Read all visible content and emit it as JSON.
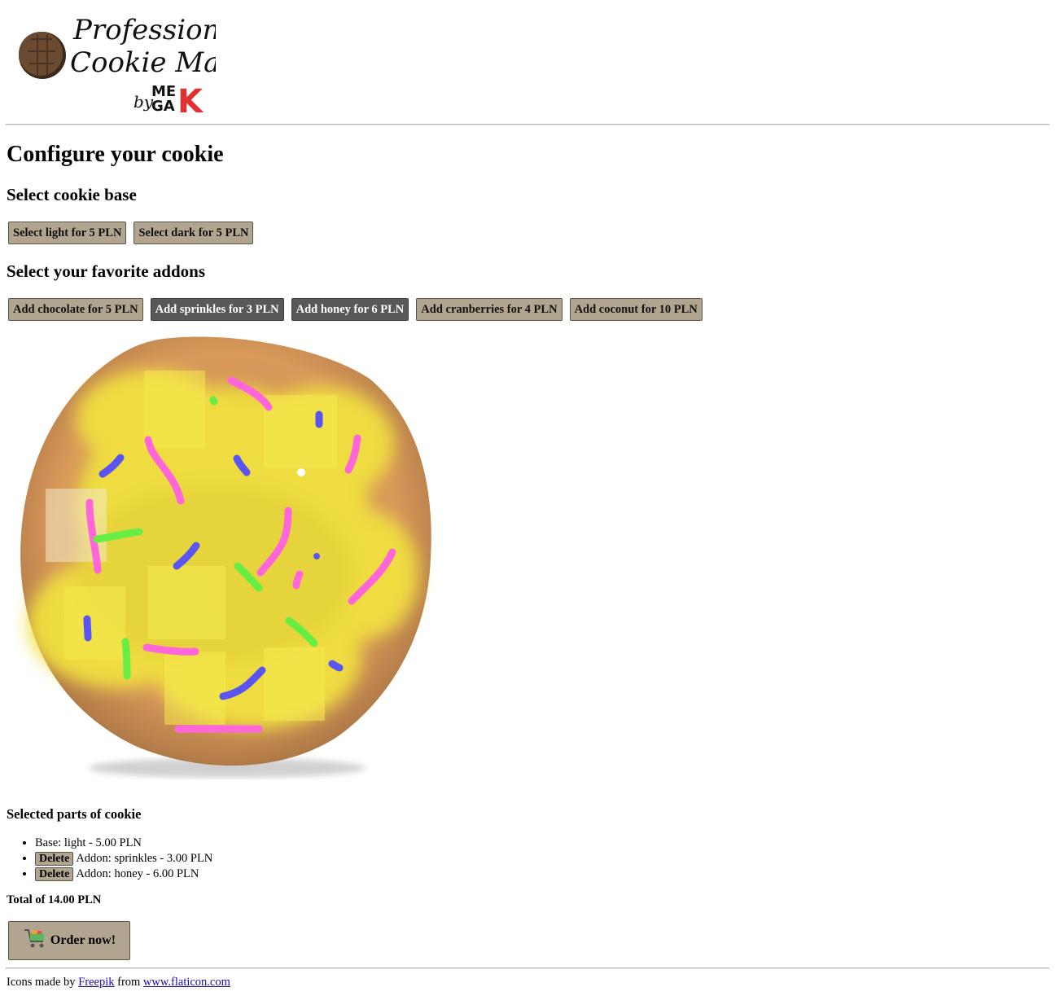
{
  "logo": {
    "line1": "Professional",
    "line2": "Cookie Maker",
    "by": "by",
    "brand_top": "ME",
    "brand_bottom": "GA",
    "brand_x": "K"
  },
  "page_title": "Configure your cookie",
  "base_section": {
    "heading": "Select cookie base",
    "buttons": [
      {
        "label": "Select light for 5 PLN",
        "active": false
      },
      {
        "label": "Select dark for 5 PLN",
        "active": false
      }
    ]
  },
  "addons_section": {
    "heading": "Select your favorite addons",
    "buttons": [
      {
        "label": "Add chocolate for 5 PLN",
        "active": false
      },
      {
        "label": "Add sprinkles for 3 PLN",
        "active": true
      },
      {
        "label": "Add honey for 6 PLN",
        "active": true
      },
      {
        "label": "Add cranberries for 4 PLN",
        "active": false
      },
      {
        "label": "Add coconut for 10 PLN",
        "active": false
      }
    ]
  },
  "cookie_preview": {
    "base": "light",
    "addons": [
      "sprinkles",
      "honey"
    ]
  },
  "selected": {
    "heading": "Selected parts of cookie",
    "items": [
      {
        "text": "Base: light - 5.00 PLN",
        "deletable": false
      },
      {
        "text": "Addon: sprinkles - 3.00 PLN",
        "deletable": true
      },
      {
        "text": "Addon: honey - 6.00 PLN",
        "deletable": true
      }
    ],
    "delete_label": "Delete"
  },
  "total": "Total of 14.00 PLN",
  "order_button": {
    "label": "Order now!",
    "icon": "shopping-cart-icon"
  },
  "footer": {
    "prefix": "Icons made by",
    "author": "Freepik",
    "middle": "from",
    "site": "www.flaticon.com"
  },
  "colors": {
    "button_bg": "#b1a58f",
    "button_active_bg": "#585858",
    "cookie_base": "#d79a5c",
    "honey": "#f0e040",
    "sprinkle_pink": "#ff66d9",
    "sprinkle_blue": "#5a55f0",
    "sprinkle_green": "#66ee44"
  }
}
